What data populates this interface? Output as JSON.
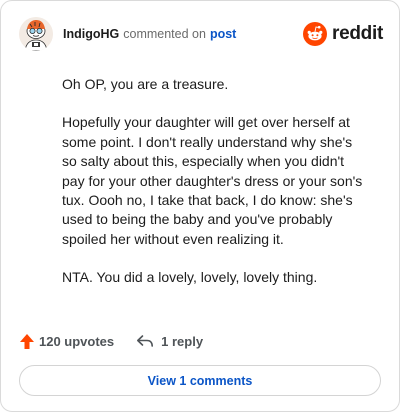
{
  "header": {
    "author": "IndigoHG",
    "action": "commented on",
    "post_link": "post",
    "brand_wordmark": "reddit",
    "avatar_icon": "snoo-avatar-icon",
    "brand_icon": "reddit-alien-icon"
  },
  "comment": {
    "paragraphs": [
      "Oh OP, you are a treasure.",
      "Hopefully your daughter will get over herself at some point. I don't really understand why she's so salty about this, especially when you didn't pay for your other daughter's dress or your son's tux. Oooh no, I take that back, I do know: she's used to being the baby and you've probably spoiled her without even realizing it.",
      "NTA. You did a lovely, lovely, lovely thing."
    ]
  },
  "footer": {
    "upvotes_label": "120 upvotes",
    "replies_label": "1 reply",
    "upvote_icon": "upvote-arrow-icon",
    "reply_icon": "reply-arrow-icon"
  },
  "view_comments_label": "View 1 comments",
  "colors": {
    "accent_orange": "#ff4500",
    "link_blue": "#0b55c7",
    "muted_text": "#6b6b6b",
    "border": "#dadada"
  }
}
